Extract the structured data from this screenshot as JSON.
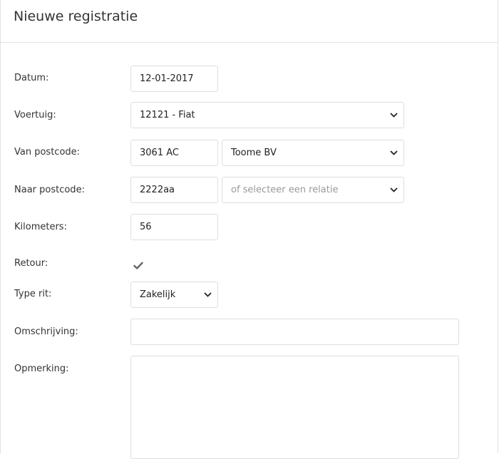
{
  "header": {
    "title": "Nieuwe registratie"
  },
  "form": {
    "datum": {
      "label": "Datum:",
      "value": "12-01-2017"
    },
    "voertuig": {
      "label": "Voertuig:",
      "value": "12121 - Fiat"
    },
    "van_postcode": {
      "label": "Van postcode:",
      "value": "3061 AC",
      "relatie": "Toome BV"
    },
    "naar_postcode": {
      "label": "Naar postcode:",
      "value": "2222aa",
      "relatie_placeholder": "of selecteer een relatie"
    },
    "kilometers": {
      "label": "Kilometers:",
      "value": "56"
    },
    "retour": {
      "label": "Retour:",
      "checked": true
    },
    "type_rit": {
      "label": "Type rit:",
      "value": "Zakelijk"
    },
    "omschrijving": {
      "label": "Omschrijving:",
      "value": ""
    },
    "opmerking": {
      "label": "Opmerking:",
      "value": ""
    }
  },
  "icons": {
    "dropdown": "chevron-down-icon",
    "retour": "checkmark-icon"
  },
  "colors": {
    "border": "#dedede",
    "text": "#333333",
    "placeholder": "#999999",
    "check": "#666666"
  }
}
